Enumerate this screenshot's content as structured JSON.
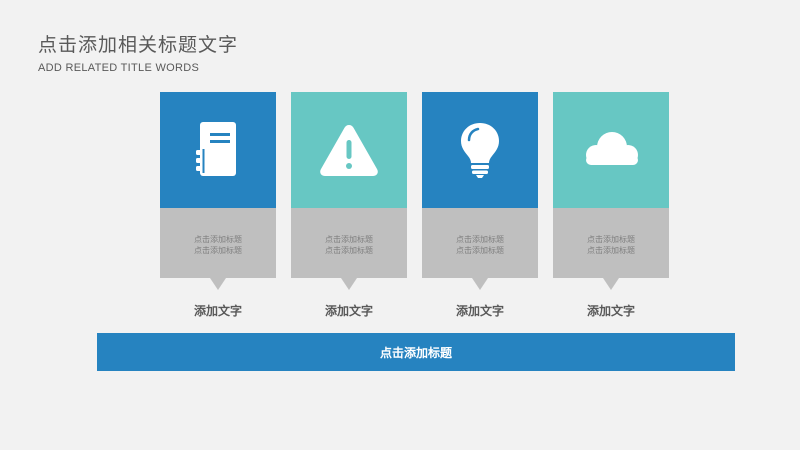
{
  "header": {
    "title": "点击添加相关标题文字",
    "subtitle": "ADD RELATED TITLE WORDS"
  },
  "colors": {
    "blue": "#2683c0",
    "teal": "#67c7c3",
    "gray": "#bfbfbf",
    "background": "#f2f2f2",
    "text": "#595959"
  },
  "cards": [
    {
      "icon": "notebook-icon",
      "color": "#2683c0",
      "line1": "点击添加标题",
      "line2": "点击添加标题",
      "caption": "添加文字"
    },
    {
      "icon": "warning-icon",
      "color": "#67c7c3",
      "line1": "点击添加标题",
      "line2": "点击添加标题",
      "caption": "添加文字"
    },
    {
      "icon": "lightbulb-icon",
      "color": "#2683c0",
      "line1": "点击添加标题",
      "line2": "点击添加标题",
      "caption": "添加文字"
    },
    {
      "icon": "cloud-icon",
      "color": "#67c7c3",
      "line1": "点击添加标题",
      "line2": "点击添加标题",
      "caption": "添加文字"
    }
  ],
  "footer": {
    "bar_label": "点击添加标题"
  }
}
